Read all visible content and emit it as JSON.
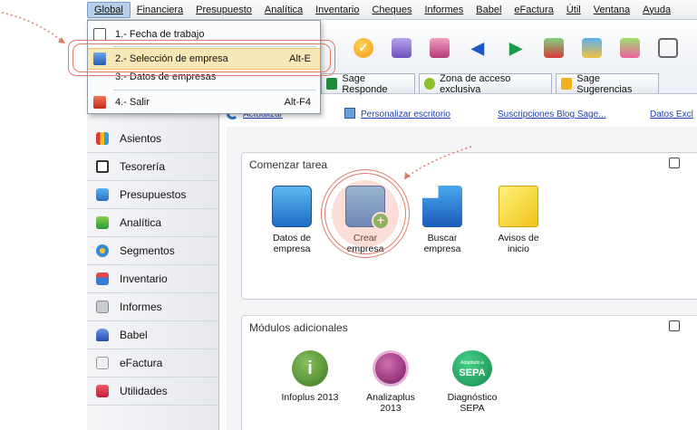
{
  "menubar": {
    "items": [
      "Global",
      "Financiera",
      "Presupuesto",
      "Analítica",
      "Inventario",
      "Cheques",
      "Informes",
      "Babel",
      "eFactura",
      "Útil",
      "Ventana",
      "Ayuda"
    ]
  },
  "global_menu": {
    "items": [
      {
        "label": "1.- Fecha de trabajo",
        "shortcut": ""
      },
      {
        "label": "2.- Selección de empresa",
        "shortcut": "Alt-E"
      },
      {
        "label": "3.- Datos de empresas",
        "shortcut": ""
      },
      {
        "label": "4.- Salir",
        "shortcut": "Alt-F4"
      }
    ]
  },
  "tabs": [
    "Sage Responde",
    "Zona de acceso exclusiva",
    "Sage Sugerencias"
  ],
  "links": [
    "Actualizar",
    "Personalizar escritorio",
    "Suscripciones Blog Sage...",
    "Datos Excl"
  ],
  "nav": [
    "Asientos",
    "Tesorería",
    "Presupuestos",
    "Analítica",
    "Segmentos",
    "Inventario",
    "Informes",
    "Babel",
    "eFactura",
    "Utilidades"
  ],
  "start_task": {
    "title": "Comenzar tarea",
    "tiles": [
      {
        "label": "Datos de empresa"
      },
      {
        "label": "Crear empresa"
      },
      {
        "label": "Buscar empresa"
      },
      {
        "label": "Avisos de inicio"
      }
    ]
  },
  "modules": {
    "title": "Módulos adicionales",
    "tiles": [
      {
        "label": "Infoplus 2013"
      },
      {
        "label": "Analizaplus 2013"
      },
      {
        "label": "Diagnóstico SEPA"
      }
    ],
    "sepa_badge_small": "Adaptado a",
    "sepa_badge": "SEPA"
  },
  "colors": {
    "annotation": "#e07a6a",
    "highlight": "#f8e7b7",
    "link": "#1a3fae"
  }
}
